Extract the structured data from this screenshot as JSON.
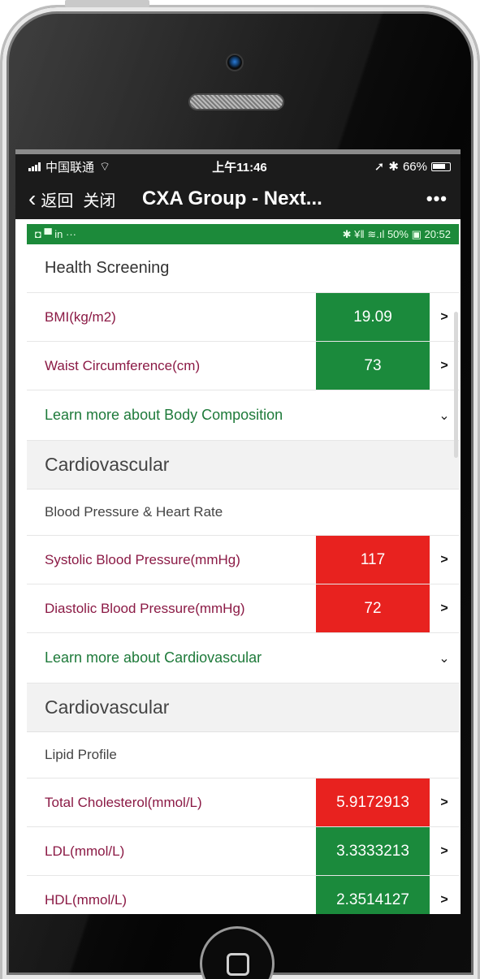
{
  "statusbar": {
    "carrier": "中国联通",
    "time": "上午11:46",
    "battery": "66%"
  },
  "nav": {
    "back_label": "返回",
    "close_label": "关闭",
    "title": "CXA Group - Next...",
    "more_label": "•••"
  },
  "android_status": {
    "apps": "◘ ▀ in ···",
    "right": "✱ ¥‖ ≋.ıl 50% ▣ 20:52"
  },
  "health_screening": {
    "title": "Health Screening",
    "rows": [
      {
        "label": "BMI(kg/m2)",
        "value": "19.09",
        "status": "normal"
      },
      {
        "label": "Waist Circumference(cm)",
        "value": "73",
        "status": "normal"
      }
    ],
    "learn_more": "Learn more about Body Composition"
  },
  "cardio_bp": {
    "title": "Cardiovascular",
    "subtitle": "Blood Pressure & Heart Rate",
    "rows": [
      {
        "label": "Systolic Blood Pressure(mmHg)",
        "value": "117",
        "status": "alert"
      },
      {
        "label": "Diastolic Blood Pressure(mmHg)",
        "value": "72",
        "status": "alert"
      }
    ],
    "learn_more": "Learn more about Cardiovascular"
  },
  "cardio_lipid": {
    "title": "Cardiovascular",
    "subtitle": "Lipid Profile",
    "rows": [
      {
        "label": "Total Cholesterol(mmol/L)",
        "value": "5.9172913",
        "status": "alert"
      },
      {
        "label": "LDL(mmol/L)",
        "value": "3.3333213",
        "status": "normal"
      },
      {
        "label": "HDL(mmol/L)",
        "value": "2.3514127",
        "status": "normal"
      }
    ]
  },
  "colors": {
    "normal": "#1b8a3c",
    "alert": "#e8221f",
    "label": "#8b1a45",
    "link": "#1e7a3a"
  },
  "icons": {
    "row_arrow": "chevron-right-icon",
    "learn_caret": "chevron-down-icon"
  }
}
